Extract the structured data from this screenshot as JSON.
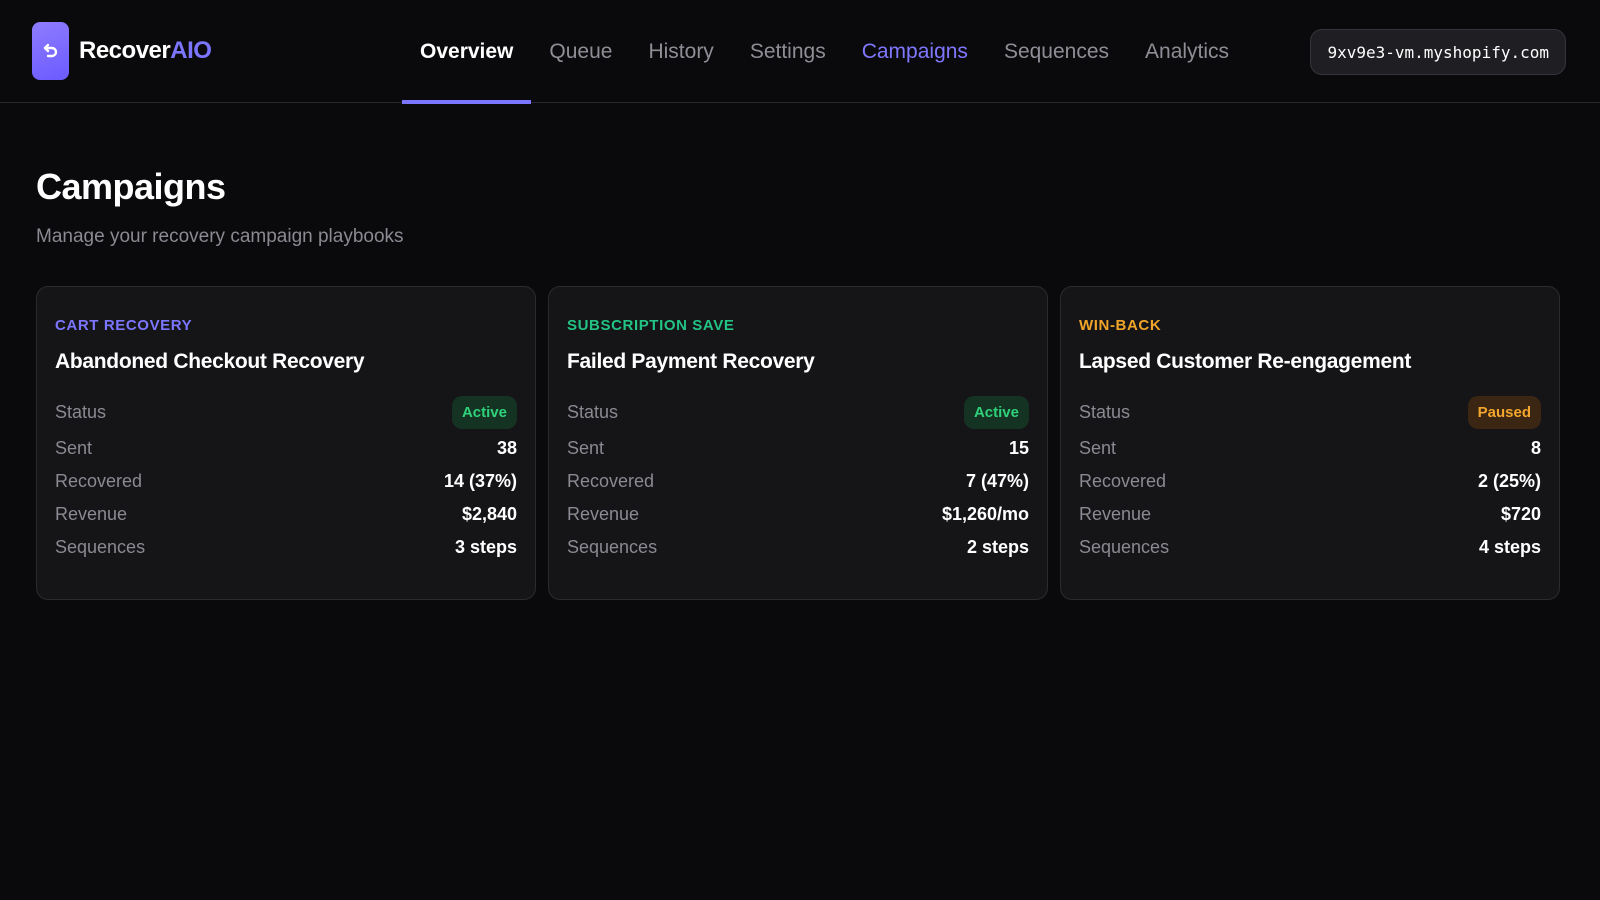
{
  "app": {
    "brand_part1": "Recover",
    "brand_part2": "AIO",
    "logo_icon": "return-arrow-icon",
    "accent_color": "#7c75ff"
  },
  "nav": {
    "items": [
      "Overview",
      "Queue",
      "History",
      "Settings",
      "Campaigns",
      "Sequences",
      "Analytics"
    ],
    "active_underline": "Overview",
    "current_page": "Campaigns"
  },
  "shop": {
    "domain": "9xv9e3-vm.myshopify.com"
  },
  "page": {
    "title": "Campaigns",
    "subtitle": "Manage your recovery campaign playbooks"
  },
  "row_labels": {
    "status": "Status",
    "sent": "Sent",
    "recovered": "Recovered",
    "revenue": "Revenue",
    "sequences": "Sequences"
  },
  "campaigns": [
    {
      "category": "CART RECOVERY",
      "category_color": "#7c75ff",
      "title": "Abandoned Checkout Recovery",
      "status": "Active",
      "status_color": "#2fd27a",
      "status_bg": "#143322",
      "sent": "38",
      "recovered": "14 (37%)",
      "revenue": "$2,840",
      "sequences": "3 steps"
    },
    {
      "category": "SUBSCRIPTION SAVE",
      "category_color": "#22c384",
      "title": "Failed Payment Recovery",
      "status": "Active",
      "status_color": "#2fd27a",
      "status_bg": "#143322",
      "sent": "15",
      "recovered": "7 (47%)",
      "revenue": "$1,260/mo",
      "sequences": "2 steps"
    },
    {
      "category": "WIN-BACK",
      "category_color": "#f0a42a",
      "title": "Lapsed Customer Re-engagement",
      "status": "Paused",
      "status_color": "#f4a62e",
      "status_bg": "#3a2612",
      "sent": "8",
      "recovered": "2 (25%)",
      "revenue": "$720",
      "sequences": "4 steps"
    }
  ]
}
